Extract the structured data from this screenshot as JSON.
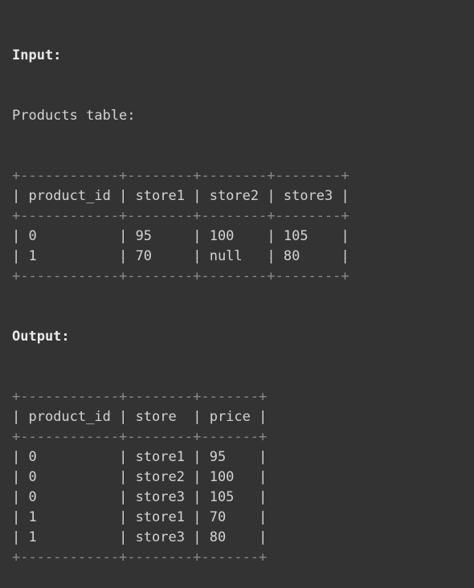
{
  "input_label": "Input:",
  "products_label": "Products table:",
  "output_label": "Output:",
  "input_table": {
    "columns": [
      "product_id",
      "store1",
      "store2",
      "store3"
    ],
    "rows": [
      [
        "0",
        "95",
        "100",
        "105"
      ],
      [
        "1",
        "70",
        "null",
        "80"
      ]
    ]
  },
  "output_table": {
    "columns": [
      "product_id",
      "store",
      "price"
    ],
    "rows": [
      [
        "0",
        "store1",
        "95"
      ],
      [
        "0",
        "store2",
        "100"
      ],
      [
        "0",
        "store3",
        "105"
      ],
      [
        "1",
        "store1",
        "70"
      ],
      [
        "1",
        "store3",
        "80"
      ]
    ]
  },
  "colors": {
    "background": "#333333",
    "text": "#d4d4d4",
    "heading": "#eaeaea",
    "border": "#8a8a8a"
  }
}
